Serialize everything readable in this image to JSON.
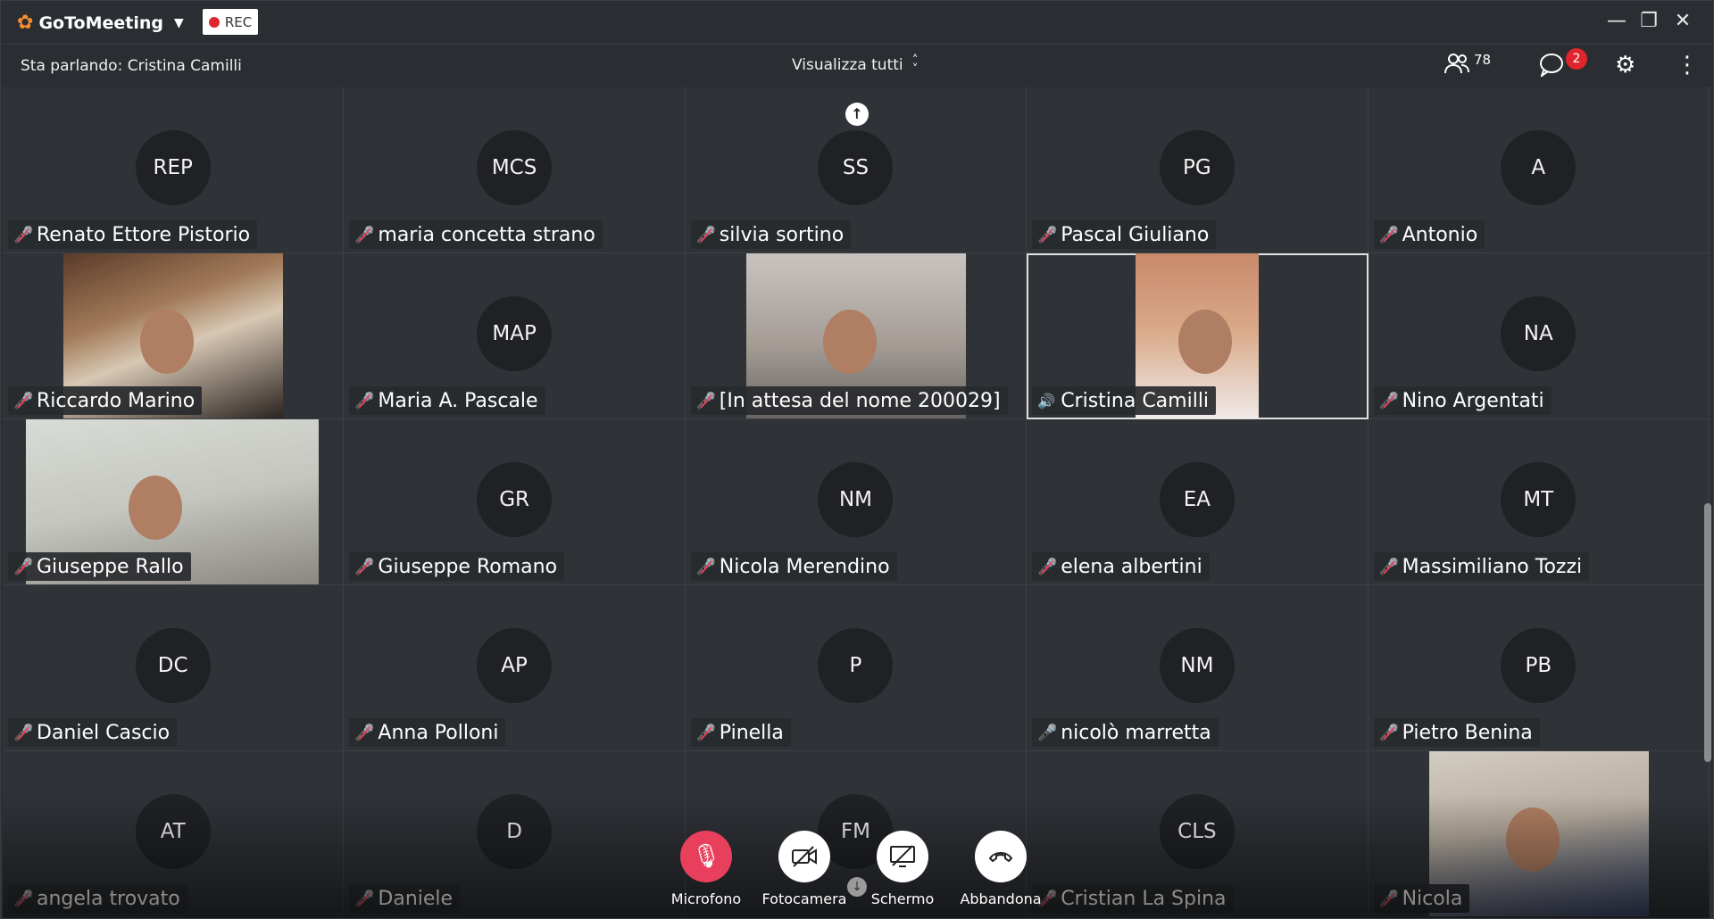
{
  "app": {
    "name": "GoToMeeting",
    "rec_label": "REC"
  },
  "subbar": {
    "speaking": "Sta parlando: Cristina Camilli",
    "view_label": "Visualizza tutti",
    "participants_count": "78",
    "chat_badge": "2"
  },
  "tiles": [
    {
      "initials": "REP",
      "name": "Renato Ettore Pistorio",
      "mic": "off"
    },
    {
      "initials": "MCS",
      "name": "maria concetta strano",
      "mic": "off"
    },
    {
      "initials": "SS",
      "name": "silvia sortino",
      "mic": "off"
    },
    {
      "initials": "PG",
      "name": "Pascal Giuliano",
      "mic": "off"
    },
    {
      "initials": "A",
      "name": "Antonio",
      "mic": "off"
    },
    {
      "initials": "",
      "name": "Riccardo Marino",
      "mic": "off",
      "video": true
    },
    {
      "initials": "MAP",
      "name": "Maria A. Pascale",
      "mic": "off"
    },
    {
      "initials": "",
      "name": "[In attesa del nome 200029]",
      "mic": "off",
      "video": true
    },
    {
      "initials": "",
      "name": "Cristina Camilli",
      "mic": "speaking",
      "video": true
    },
    {
      "initials": "NA",
      "name": "Nino Argentati",
      "mic": "off"
    },
    {
      "initials": "",
      "name": "Giuseppe Rallo",
      "mic": "off",
      "video": true
    },
    {
      "initials": "GR",
      "name": "Giuseppe Romano",
      "mic": "off"
    },
    {
      "initials": "NM",
      "name": "Nicola Merendino",
      "mic": "off"
    },
    {
      "initials": "EA",
      "name": "elena albertini",
      "mic": "off"
    },
    {
      "initials": "MT",
      "name": "Massimiliano Tozzi",
      "mic": "off"
    },
    {
      "initials": "DC",
      "name": "Daniel Cascio",
      "mic": "off"
    },
    {
      "initials": "AP",
      "name": "Anna Polloni",
      "mic": "off"
    },
    {
      "initials": "P",
      "name": "Pinella",
      "mic": "off"
    },
    {
      "initials": "NM",
      "name": "nicolò marretta",
      "mic": "on"
    },
    {
      "initials": "PB",
      "name": "Pietro Benina",
      "mic": "off"
    },
    {
      "initials": "AT",
      "name": "angela trovato",
      "mic": "off"
    },
    {
      "initials": "D",
      "name": "Daniele",
      "mic": "off"
    },
    {
      "initials": "FM",
      "name": "",
      "mic": "off"
    },
    {
      "initials": "CLS",
      "name": "Cristian La Spina",
      "mic": "off"
    },
    {
      "initials": "",
      "name": "Nicola",
      "mic": "off",
      "video": true
    }
  ],
  "controls": {
    "mic_label": "Microfono",
    "camera_label": "Fotocamera",
    "screen_label": "Schermo",
    "leave_label": "Abbandona"
  }
}
